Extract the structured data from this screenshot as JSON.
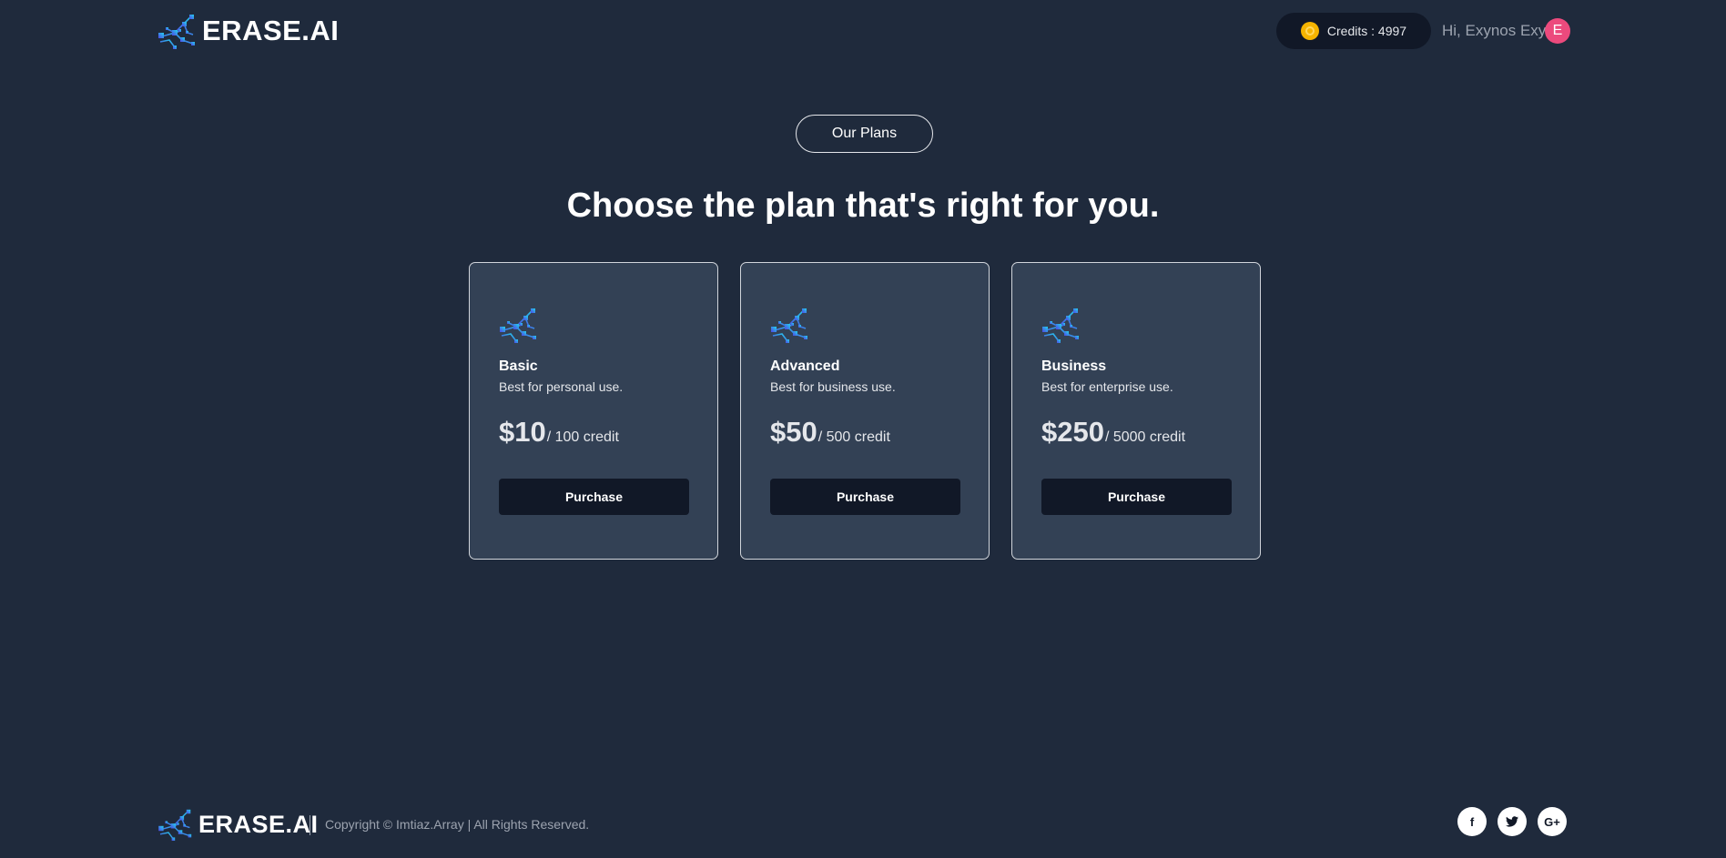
{
  "header": {
    "brand": "ERASE.AI",
    "credits_label": "Credits : 4997",
    "greeting": "Hi, Exynos Exy",
    "avatar_initial": "E"
  },
  "main": {
    "badge": "Our Plans",
    "title": "Choose the plan that's right for you.",
    "plans": [
      {
        "name": "Basic",
        "description": "Best for personal use.",
        "price": "$10",
        "per": "/ 100 credit",
        "button": "Purchase"
      },
      {
        "name": "Advanced",
        "description": "Best for business use.",
        "price": "$50",
        "per": "/ 500 credit",
        "button": "Purchase"
      },
      {
        "name": "Business",
        "description": "Best for enterprise use.",
        "price": "$250",
        "per": "/ 5000 credit",
        "button": "Purchase"
      }
    ]
  },
  "footer": {
    "brand": "ERASE.AI",
    "copyright": "Copyright © Imtiaz.Array | All Rights Reserved.",
    "social": [
      {
        "icon": "facebook-icon",
        "glyph": "f"
      },
      {
        "icon": "twitter-icon",
        "glyph": "t"
      },
      {
        "icon": "google-plus-icon",
        "glyph": "G+"
      }
    ]
  },
  "colors": {
    "background": "#1f2a3c",
    "card": "#334155",
    "button": "#111827",
    "avatar": "#ec4a7d",
    "coin": "#f5b400"
  }
}
